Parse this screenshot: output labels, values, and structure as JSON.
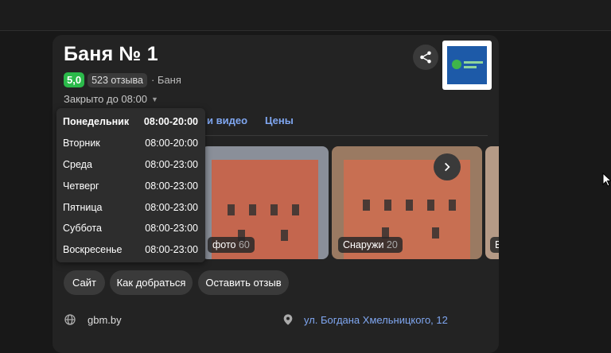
{
  "place": {
    "title": "Баня № 1",
    "rating": "5,0",
    "reviews": "523 отзыва",
    "category": "· Баня",
    "hours_status": "Закрыто до 08:00"
  },
  "tabs": [
    {
      "label": "и видео"
    },
    {
      "label": "Цены"
    }
  ],
  "schedule": [
    {
      "day": "Понедельник",
      "hours": "08:00-20:00",
      "today": true
    },
    {
      "day": "Вторник",
      "hours": "08:00-20:00"
    },
    {
      "day": "Среда",
      "hours": "08:00-23:00"
    },
    {
      "day": "Четверг",
      "hours": "08:00-23:00"
    },
    {
      "day": "Пятница",
      "hours": "08:00-23:00"
    },
    {
      "day": "Суббота",
      "hours": "08:00-23:00"
    },
    {
      "day": "Воскресенье",
      "hours": "08:00-23:00"
    }
  ],
  "photos": [
    {
      "label": "фото",
      "count": "60"
    },
    {
      "label": "Снаружи",
      "count": "20"
    },
    {
      "label": "В"
    }
  ],
  "buttons": {
    "site": "Сайт",
    "route": "Как добраться",
    "review": "Оставить отзыв"
  },
  "contacts": {
    "website": "gbm.by",
    "address": "ул. Богдана Хмельницкого, 12"
  },
  "icons": {
    "share": "share-icon",
    "next": "chevron-right-icon",
    "globe": "globe-icon",
    "location": "location-pin-icon"
  },
  "colors": {
    "rating_badge": "#2bb94a",
    "link": "#7fa6f0",
    "card_bg": "#232323",
    "page_bg": "#181818"
  }
}
